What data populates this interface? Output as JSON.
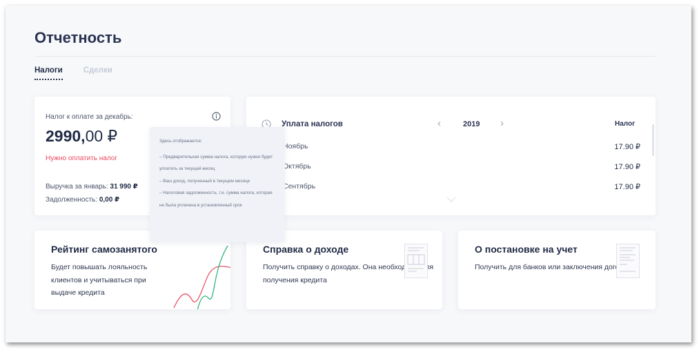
{
  "page": {
    "title": "Отчетность"
  },
  "tabs": [
    {
      "label": "Налоги",
      "active": true
    },
    {
      "label": "Сделки",
      "active": false
    }
  ],
  "tax": {
    "label": "Налог к оплате за декабрь:",
    "amount_int": "2990,",
    "amount_frac": "00 ₽",
    "warning": "Нужно оплатить налог",
    "revenue_label": "Выручка за январь:",
    "revenue_value": "31 990 ₽",
    "debt_label": "Задолженность:",
    "debt_value": "0,00 ₽"
  },
  "tooltip": {
    "heading": "Здесь отображается:",
    "items": [
      "– Предварительная сумма налога, которую нужно будет уплатить за текущий месяц",
      "– Ваш доход, полученный в текущем месяце",
      "– Налоговая задолженность, т.е. сумма налога, которая не была уплачена в установленный срок"
    ]
  },
  "payments": {
    "title": "Уплата налогов",
    "year": "2019",
    "column": "Налог",
    "rows": [
      {
        "month": "Ноябрь",
        "sum": "17.90 ₽"
      },
      {
        "month": "Октябрь",
        "sum": "17.90 ₽"
      },
      {
        "month": "Сентябрь",
        "sum": "17.90 ₽"
      }
    ]
  },
  "cards": [
    {
      "title": "Рейтинг самозанятого",
      "text": "Будет повышать лояльность клиентов и учитываться при выдаче кредита"
    },
    {
      "title": "Справка о доходе",
      "text": "Получить справку о доходах. Она необходима для получения кредита"
    },
    {
      "title": "О постановке на учет",
      "text": "Получить для банков или заключения договоров"
    }
  ],
  "colors": {
    "accent": "#1f2a44",
    "warning": "#e84a5f",
    "chart_red": "#e8556a",
    "chart_green": "#2fb57a"
  },
  "icons": [
    "info-icon",
    "clock-icon",
    "chevron-left-icon",
    "chevron-right-icon",
    "chevron-down-icon",
    "chart-icon",
    "document-icon"
  ]
}
